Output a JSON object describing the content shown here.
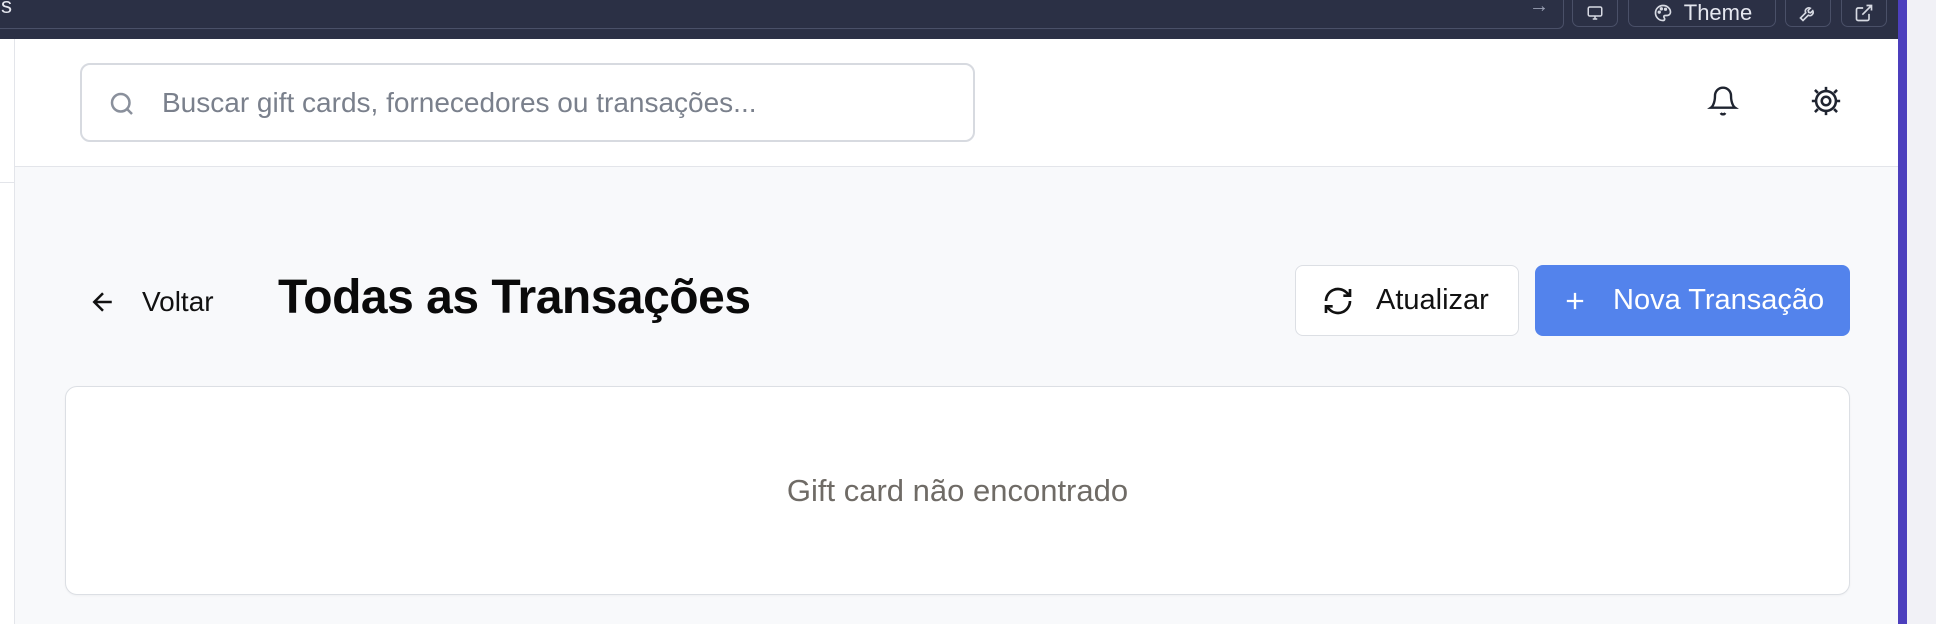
{
  "topbar": {
    "left_fragment": "s",
    "theme_label": "Theme"
  },
  "header": {
    "search_placeholder": "Buscar gift cards, fornecedores ou transações..."
  },
  "page": {
    "back_label": "Voltar",
    "title": "Todas as Transações",
    "refresh_label": "Atualizar",
    "new_label": "Nova Transação",
    "empty_message": "Gift card não encontrado"
  },
  "colors": {
    "primary": "#5383ec",
    "topbar": "#2b3045",
    "edge": "#4c3fbd"
  },
  "icons": [
    "arrow-right-icon",
    "monitor-icon",
    "palette-icon",
    "wrench-icon",
    "external-link-icon",
    "search-icon",
    "bell-icon",
    "gear-icon",
    "arrow-left-icon",
    "refresh-icon",
    "plus-icon"
  ]
}
